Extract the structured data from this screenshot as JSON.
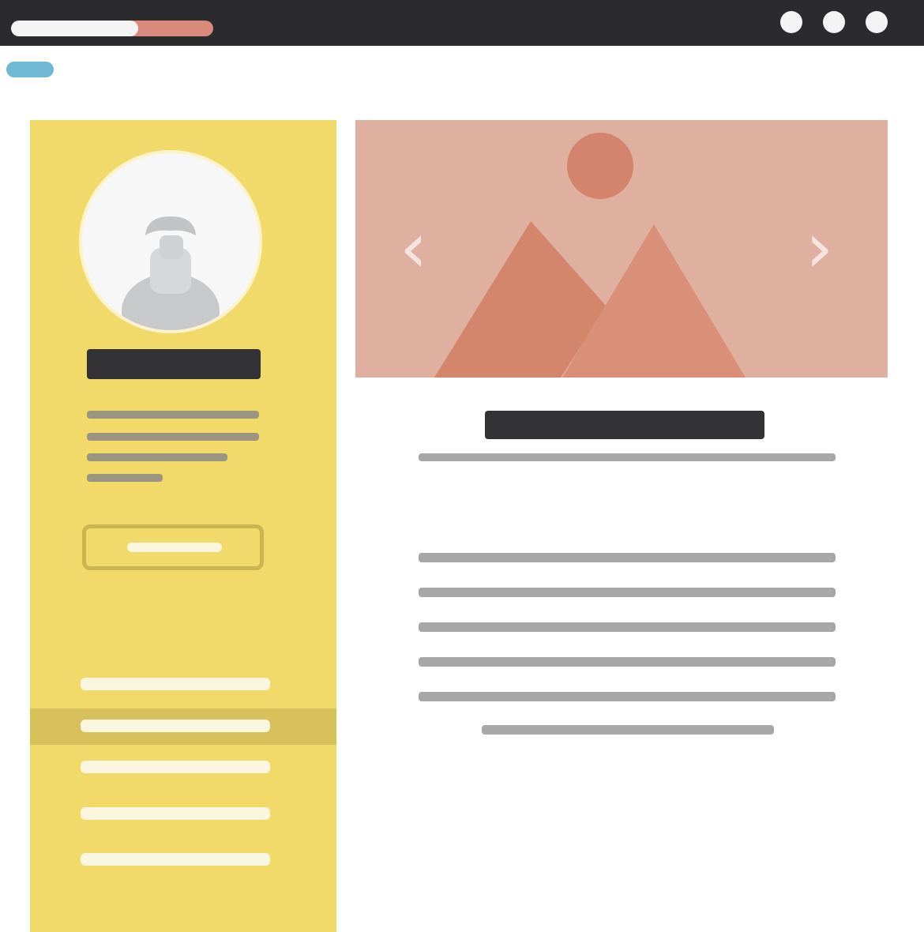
{
  "browser": {
    "title_bar_colors": {
      "background": "#2b2b2d",
      "progress": "#d98a7c",
      "text": "#f4f4f4"
    },
    "window_controls": [
      "window-dot",
      "window-dot",
      "window-dot"
    ]
  },
  "address_bar": {
    "load_progress_fraction": 0.63
  },
  "tag": {
    "color": "#6fb8d6"
  },
  "sidebar": {
    "background": "#f2da6a",
    "avatar_icon": "person-placeholder-icon",
    "nav_items_count_shown": 5,
    "active_nav_index": 1
  },
  "carousel": {
    "background": "#dfafa0",
    "prev_icon": "‹",
    "next_icon": "›",
    "image_icon": "landscape-placeholder-icon"
  },
  "content": {
    "heading_color": "#333336",
    "body_line_color": "#a7a7a7"
  }
}
